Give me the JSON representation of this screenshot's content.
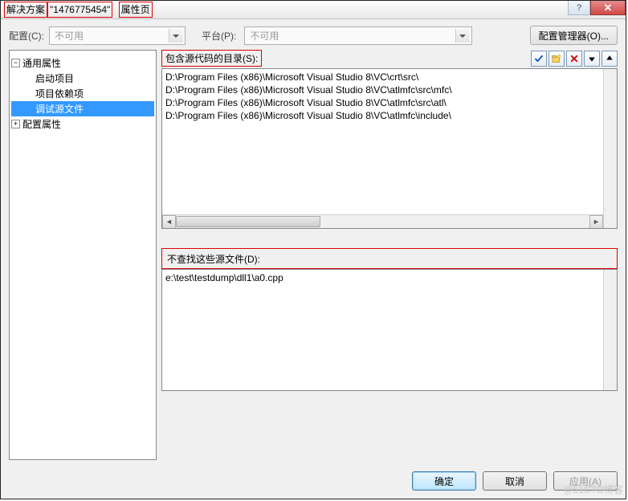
{
  "title": {
    "t1": "解决方案",
    "t2": "\"1476775454\"",
    "t3": "属性页"
  },
  "toprow": {
    "cfg_label": "配置(C):",
    "cfg_value": "不可用",
    "plat_label": "平台(P):",
    "plat_value": "不可用",
    "cfgmgr": "配置管理器(O)..."
  },
  "tree": {
    "n1": "通用属性",
    "n1a": "启动项目",
    "n1b": "项目依赖项",
    "n1c": "调试源文件",
    "n2": "配置属性"
  },
  "section1": {
    "label": "包含源代码的目录(S):",
    "rows": [
      "D:\\Program Files (x86)\\Microsoft Visual Studio 8\\VC\\crt\\src\\",
      "D:\\Program Files (x86)\\Microsoft Visual Studio 8\\VC\\atlmfc\\src\\mfc\\",
      "D:\\Program Files (x86)\\Microsoft Visual Studio 8\\VC\\atlmfc\\src\\atl\\",
      "D:\\Program Files (x86)\\Microsoft Visual Studio 8\\VC\\atlmfc\\include\\"
    ]
  },
  "section2": {
    "label": "不查找这些源文件(D):",
    "rows": [
      "e:\\test\\testdump\\dll1\\a0.cpp"
    ]
  },
  "footer": {
    "ok": "确定",
    "cancel": "取消",
    "apply": "应用(A)"
  },
  "watermark": "@51CTO博客"
}
